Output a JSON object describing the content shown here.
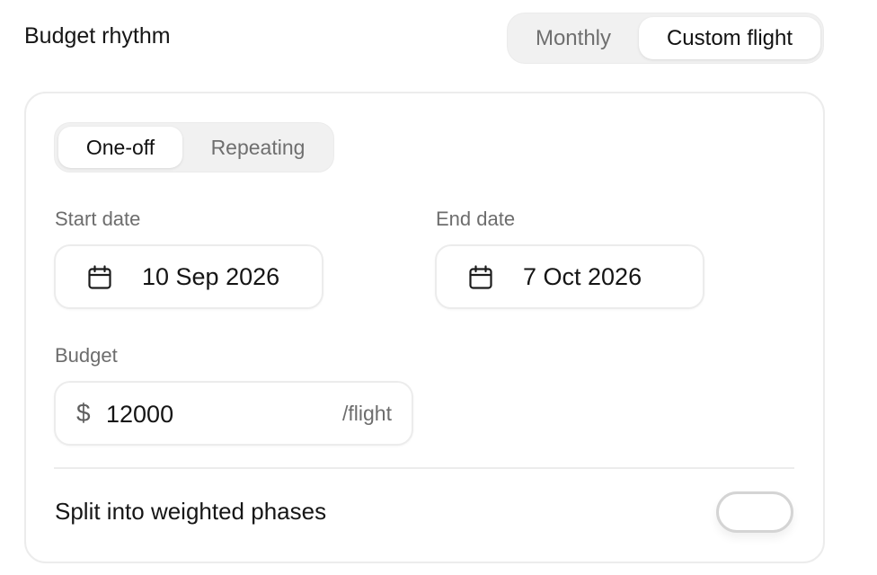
{
  "section_title": "Budget rhythm",
  "rhythm_tabs": {
    "options": [
      "Monthly",
      "Custom flight"
    ],
    "selected": "Custom flight"
  },
  "frequency_tabs": {
    "options": [
      "One-off",
      "Repeating"
    ],
    "selected": "One-off"
  },
  "start_date": {
    "label": "Start date",
    "value": "10 Sep 2026",
    "icon": "calendar-icon"
  },
  "end_date": {
    "label": "End date",
    "value": "7 Oct 2026",
    "icon": "calendar-icon"
  },
  "budget": {
    "label": "Budget",
    "currency_symbol": "$",
    "value": "12000",
    "suffix": "/flight"
  },
  "split_phases": {
    "label": "Split into weighted phases",
    "enabled": false
  },
  "colors": {
    "text_primary": "#111111",
    "text_muted": "#6d6d6d",
    "segment_bg": "#f1f1f1",
    "border": "#ececec",
    "toggle_border": "#d4d4d4"
  }
}
